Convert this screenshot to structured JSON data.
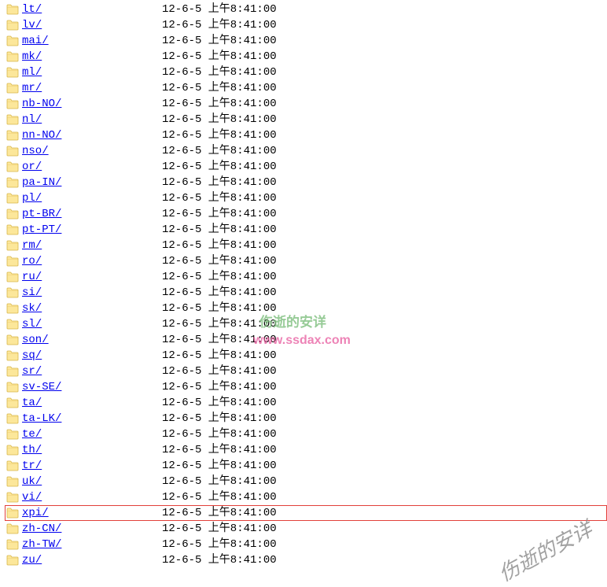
{
  "listing": [
    {
      "name": "lt/",
      "date": "12-6-5 上午8:41:00",
      "highlighted": false
    },
    {
      "name": "lv/",
      "date": "12-6-5 上午8:41:00",
      "highlighted": false
    },
    {
      "name": "mai/",
      "date": "12-6-5 上午8:41:00",
      "highlighted": false
    },
    {
      "name": "mk/",
      "date": "12-6-5 上午8:41:00",
      "highlighted": false
    },
    {
      "name": "ml/",
      "date": "12-6-5 上午8:41:00",
      "highlighted": false
    },
    {
      "name": "mr/",
      "date": "12-6-5 上午8:41:00",
      "highlighted": false
    },
    {
      "name": "nb-NO/",
      "date": "12-6-5 上午8:41:00",
      "highlighted": false
    },
    {
      "name": "nl/",
      "date": "12-6-5 上午8:41:00",
      "highlighted": false
    },
    {
      "name": "nn-NO/",
      "date": "12-6-5 上午8:41:00",
      "highlighted": false
    },
    {
      "name": "nso/",
      "date": "12-6-5 上午8:41:00",
      "highlighted": false
    },
    {
      "name": "or/",
      "date": "12-6-5 上午8:41:00",
      "highlighted": false
    },
    {
      "name": "pa-IN/",
      "date": "12-6-5 上午8:41:00",
      "highlighted": false
    },
    {
      "name": "pl/",
      "date": "12-6-5 上午8:41:00",
      "highlighted": false
    },
    {
      "name": "pt-BR/",
      "date": "12-6-5 上午8:41:00",
      "highlighted": false
    },
    {
      "name": "pt-PT/",
      "date": "12-6-5 上午8:41:00",
      "highlighted": false
    },
    {
      "name": "rm/",
      "date": "12-6-5 上午8:41:00",
      "highlighted": false
    },
    {
      "name": "ro/",
      "date": "12-6-5 上午8:41:00",
      "highlighted": false
    },
    {
      "name": "ru/",
      "date": "12-6-5 上午8:41:00",
      "highlighted": false
    },
    {
      "name": "si/",
      "date": "12-6-5 上午8:41:00",
      "highlighted": false
    },
    {
      "name": "sk/",
      "date": "12-6-5 上午8:41:00",
      "highlighted": false
    },
    {
      "name": "sl/",
      "date": "12-6-5 上午8:41:00",
      "highlighted": false
    },
    {
      "name": "son/",
      "date": "12-6-5 上午8:41:00",
      "highlighted": false
    },
    {
      "name": "sq/",
      "date": "12-6-5 上午8:41:00",
      "highlighted": false
    },
    {
      "name": "sr/",
      "date": "12-6-5 上午8:41:00",
      "highlighted": false
    },
    {
      "name": "sv-SE/",
      "date": "12-6-5 上午8:41:00",
      "highlighted": false
    },
    {
      "name": "ta/",
      "date": "12-6-5 上午8:41:00",
      "highlighted": false
    },
    {
      "name": "ta-LK/",
      "date": "12-6-5 上午8:41:00",
      "highlighted": false
    },
    {
      "name": "te/",
      "date": "12-6-5 上午8:41:00",
      "highlighted": false
    },
    {
      "name": "th/",
      "date": "12-6-5 上午8:41:00",
      "highlighted": false
    },
    {
      "name": "tr/",
      "date": "12-6-5 上午8:41:00",
      "highlighted": false
    },
    {
      "name": "uk/",
      "date": "12-6-5 上午8:41:00",
      "highlighted": false
    },
    {
      "name": "vi/",
      "date": "12-6-5 上午8:41:00",
      "highlighted": false
    },
    {
      "name": "xpi/",
      "date": "12-6-5 上午8:41:00",
      "highlighted": true
    },
    {
      "name": "zh-CN/",
      "date": "12-6-5 上午8:41:00",
      "highlighted": false
    },
    {
      "name": "zh-TW/",
      "date": "12-6-5 上午8:41:00",
      "highlighted": false
    },
    {
      "name": "zu/",
      "date": "12-6-5 上午8:41:00",
      "highlighted": false
    }
  ],
  "watermark_center_line1": "伤逝的安详",
  "watermark_center_line2": "www.ssdax.com",
  "watermark_corner": "伤逝的安详"
}
